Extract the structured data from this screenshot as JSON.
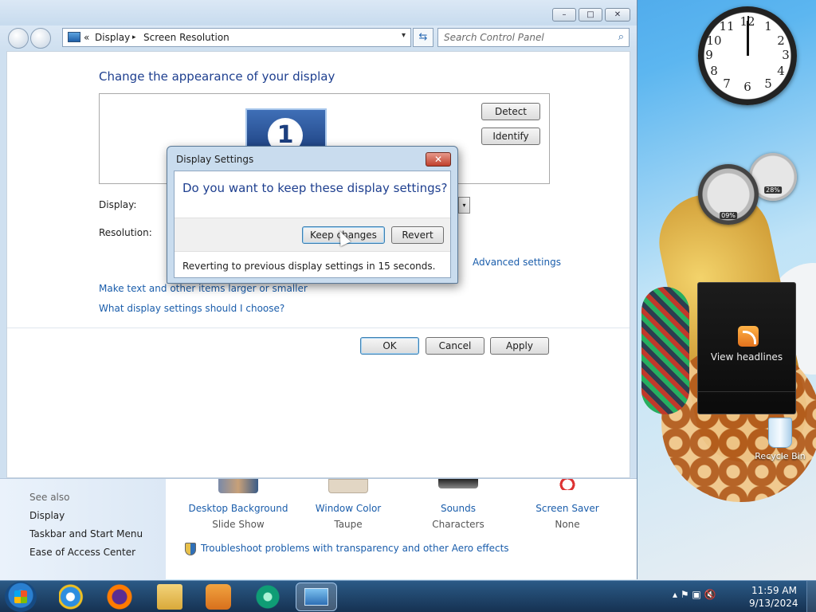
{
  "window": {
    "controls": {
      "minimize": "–",
      "maximize": "□",
      "close": "✕"
    },
    "address": {
      "back_chevron": "«",
      "crumb1": "Display",
      "crumb_sep": "▸",
      "crumb2": "Screen Resolution",
      "dropdown": "▾"
    },
    "refresh_icon": "⇆",
    "search": {
      "placeholder": "Search Control Panel",
      "icon": "⌕"
    }
  },
  "screen_resolution": {
    "heading": "Change the appearance of your display",
    "monitor_number": "1",
    "detect_label": "Detect",
    "identify_label": "Identify",
    "display_label": "Display:",
    "resolution_label": "Resolution:",
    "combo_arrow": "▾",
    "advanced_link": "Advanced settings",
    "link_text_size": "Make text and other items larger or smaller",
    "link_which_settings": "What display settings should I choose?",
    "ok_label": "OK",
    "cancel_label": "Cancel",
    "apply_label": "Apply"
  },
  "bottom": {
    "see_also": "See also",
    "links": [
      "Display",
      "Taskbar and Start Menu",
      "Ease of Access Center"
    ],
    "items": [
      {
        "name": "Desktop Background",
        "sub": "Slide Show"
      },
      {
        "name": "Window Color",
        "sub": "Taupe"
      },
      {
        "name": "Sounds",
        "sub": "Characters"
      },
      {
        "name": "Screen Saver",
        "sub": "None"
      }
    ],
    "troubleshoot": "Troubleshoot problems with transparency and other Aero effects"
  },
  "dialog": {
    "title": "Display Settings",
    "close": "✕",
    "question": "Do you want to keep these display settings?",
    "keep_label": "Keep changes",
    "revert_label": "Revert",
    "message": "Reverting to previous display settings in 15 seconds."
  },
  "gadgets": {
    "clock_numbers": [
      "12",
      "1",
      "2",
      "3",
      "4",
      "5",
      "6",
      "7",
      "8",
      "9",
      "10",
      "11"
    ],
    "cpu_percent": "09%",
    "memory_percent": "28%",
    "feed_label": "View headlines",
    "recycle_bin": "Recycle Bin"
  },
  "taskbar": {
    "tray_icons": "▴  ⚑  ▣  🔇",
    "time": "11:59 AM",
    "date": "9/13/2024"
  },
  "colors": {
    "link": "#1a5dab",
    "heading": "#1e3f8f",
    "taskbar": "#1f3d5f"
  }
}
